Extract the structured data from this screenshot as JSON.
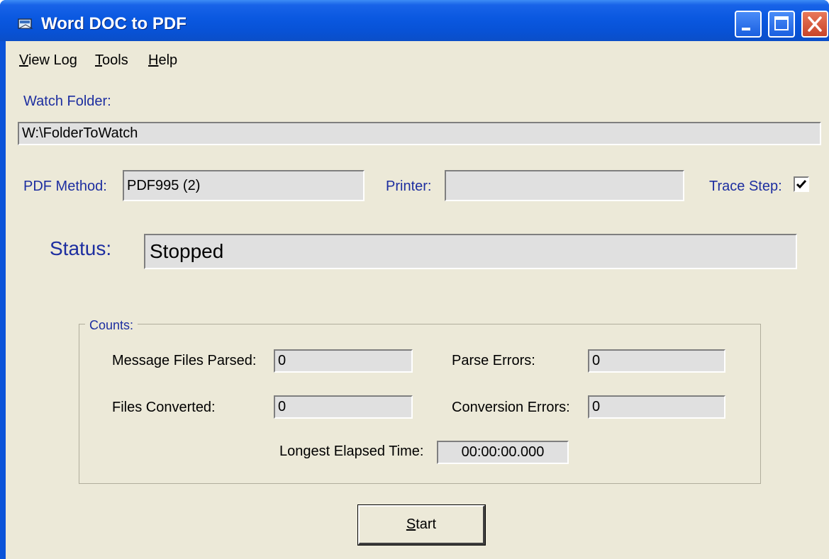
{
  "window": {
    "title": "Word DOC to PDF",
    "minimize_icon": "minimize-icon",
    "maximize_icon": "maximize-icon",
    "close_icon": "close-icon"
  },
  "menu": {
    "items": [
      {
        "label": "View Log",
        "mnemonic": "V"
      },
      {
        "label": "Tools",
        "mnemonic": "T"
      },
      {
        "label": "Help",
        "mnemonic": "H"
      }
    ]
  },
  "watch_folder": {
    "label": "Watch Folder:",
    "value": "W:\\FolderToWatch"
  },
  "pdf_method": {
    "label": "PDF Method:",
    "value": "PDF995 (2)"
  },
  "printer": {
    "label": "Printer:",
    "value": ""
  },
  "trace_step": {
    "label": "Trace Step:",
    "checked": true
  },
  "status": {
    "label": "Status:",
    "value": "Stopped"
  },
  "counts": {
    "legend": "Counts:",
    "message_files_parsed": {
      "label": "Message Files Parsed:",
      "value": "0"
    },
    "parse_errors": {
      "label": "Parse Errors:",
      "value": "0"
    },
    "files_converted": {
      "label": "Files Converted:",
      "value": "0"
    },
    "conversion_errors": {
      "label": "Conversion Errors:",
      "value": "0"
    },
    "longest_elapsed_time": {
      "label": "Longest Elapsed Time:",
      "value": "00:00:00.000"
    }
  },
  "start_button": {
    "mnemonic": "S",
    "rest": "tart"
  },
  "colors": {
    "titlebar": "#0a53d9",
    "client_bg": "#ece9d8",
    "label_blue": "#1d2ea0",
    "field_bg": "#e0e0e0"
  }
}
